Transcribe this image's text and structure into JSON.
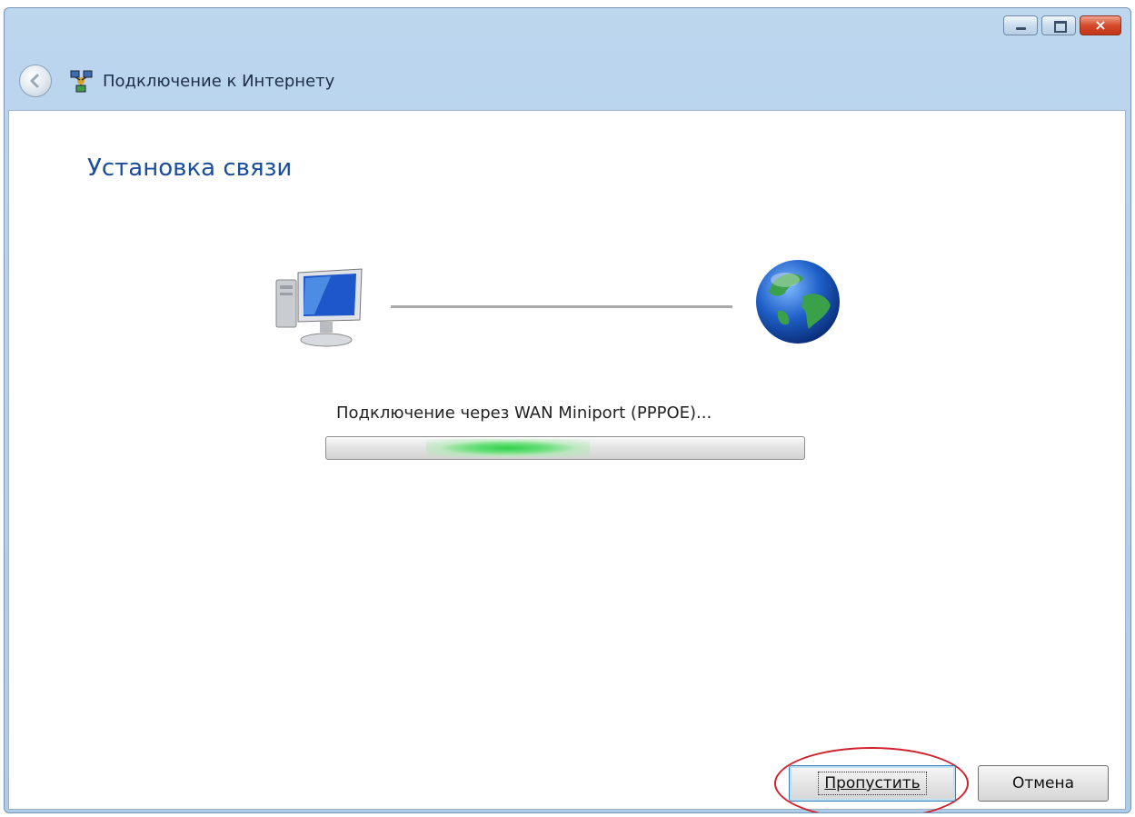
{
  "window": {
    "title": "Подключение к Интернету",
    "controls": {
      "minimize": "minimize-icon",
      "maximize": "maximize-icon",
      "close": "×"
    }
  },
  "nav": {
    "back_icon": "back-arrow-icon",
    "app_icon": "network-icon"
  },
  "page": {
    "heading": "Установка связи",
    "status": "Подключение через WAN Miniport (PPPOE)...",
    "progress_state": "indeterminate"
  },
  "illustration": {
    "left_icon": "computer-icon",
    "right_icon": "globe-icon"
  },
  "buttons": {
    "skip": "Пропустить",
    "cancel": "Отмена"
  },
  "colors": {
    "heading": "#1b4e9a",
    "highlight": "#d21f2c",
    "progress": "#2fd14a"
  }
}
